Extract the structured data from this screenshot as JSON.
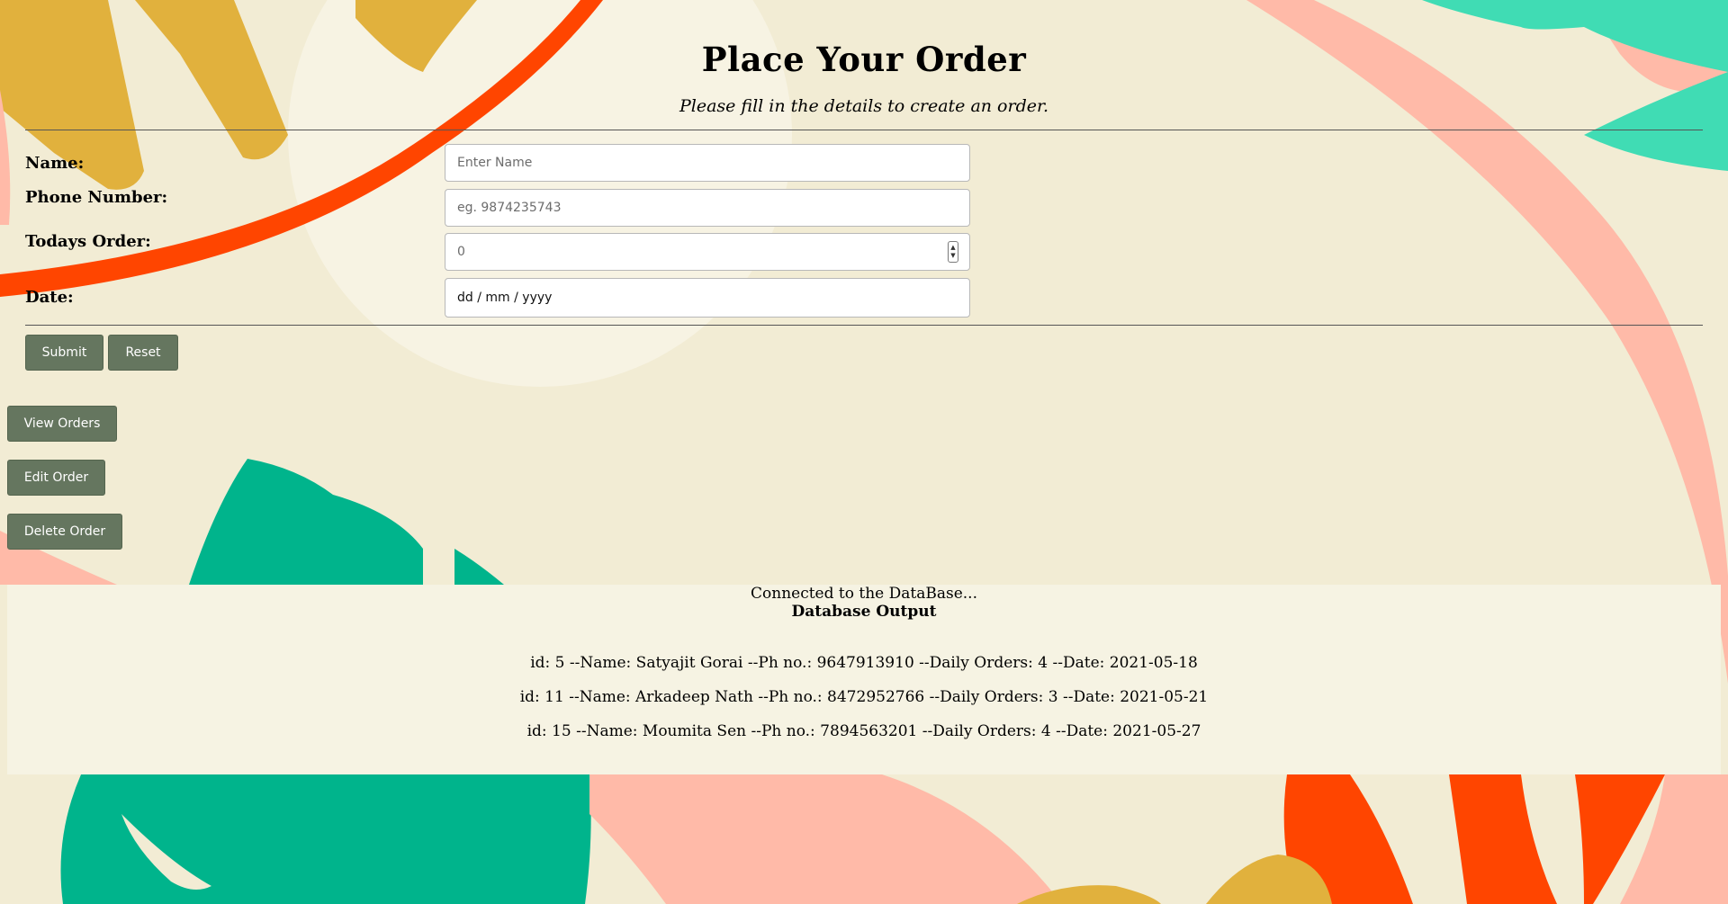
{
  "header": {
    "title": "Place Your Order",
    "subtitle": "Please fill in the details to create an order."
  },
  "form": {
    "name_label": "Name:",
    "name_placeholder": "Enter Name",
    "phone_label": "Phone Number:",
    "phone_placeholder": "eg. 9874235743",
    "order_label": "Todays Order:",
    "order_value": "0",
    "date_label": "Date:",
    "date_placeholder": "dd / mm / yyyy",
    "submit_label": "Submit",
    "reset_label": "Reset"
  },
  "actions": {
    "view_label": "View Orders",
    "edit_label": "Edit Order",
    "delete_label": "Delete Order"
  },
  "output": {
    "status": "Connected to the DataBase...",
    "heading": "Database Output",
    "rows": [
      "id: 5 --Name: Satyajit Gorai --Ph no.: 9647913910 --Daily Orders: 4 --Date: 2021-05-18",
      "id: 11 --Name: Arkadeep Nath --Ph no.: 8472952766 --Daily Orders: 3 --Date: 2021-05-21",
      "id: 15 --Name: Moumita Sen --Ph no.: 7894563201 --Daily Orders: 4 --Date: 2021-05-27"
    ]
  },
  "colors": {
    "background": "#f2ecd4",
    "button": "#65765f",
    "accent_red": "#ff4500",
    "accent_green": "#00b48c",
    "accent_mint": "#40dcb4",
    "accent_pink": "#ffbaa8",
    "accent_mustard": "#e1b13d"
  }
}
